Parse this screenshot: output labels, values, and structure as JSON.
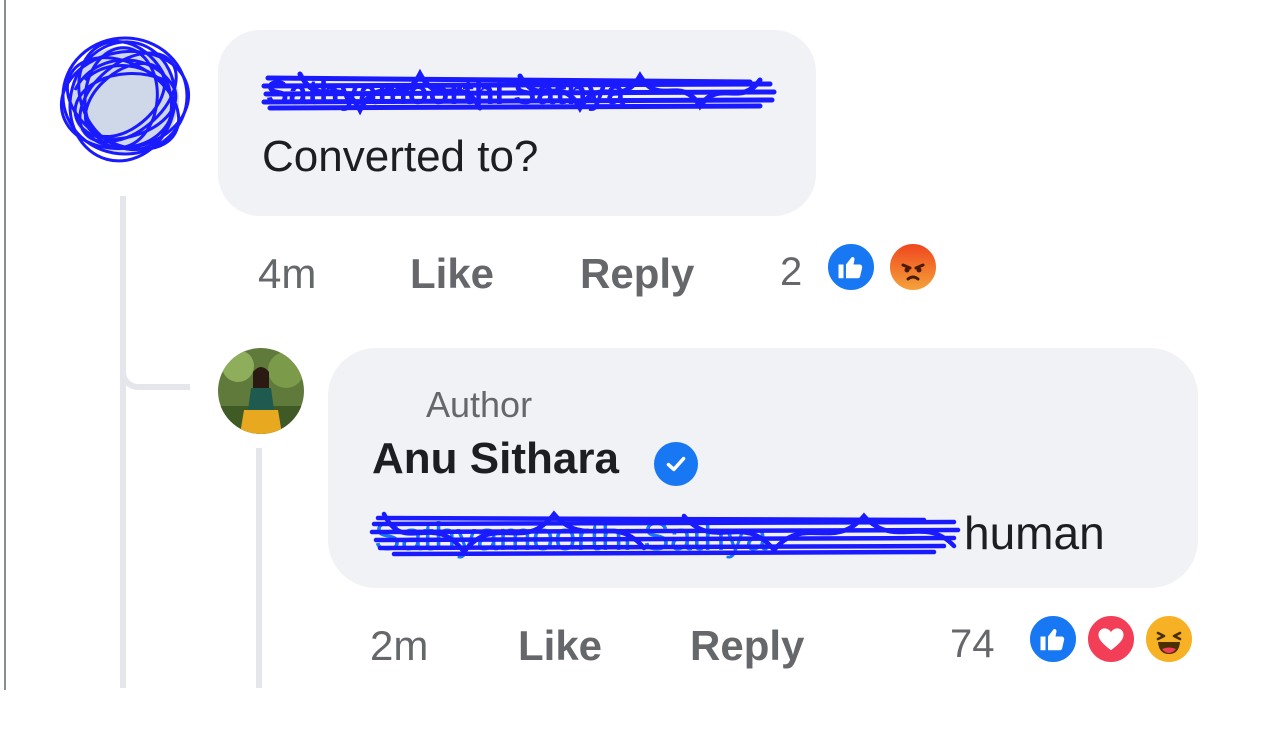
{
  "comment": {
    "author_name": "Sathyamoorthi Sathya",
    "text": "Converted to?",
    "time": "4m",
    "like_label": "Like",
    "reply_label": "Reply",
    "reaction_count": "2",
    "reactions": [
      "like-icon",
      "angry-icon"
    ]
  },
  "reply": {
    "badge": "Author",
    "author_name": "Anu Sithara",
    "mentioned_name": "Sathyamoorthi Sathya",
    "text": "human",
    "time": "2m",
    "like_label": "Like",
    "reply_label": "Reply",
    "reaction_count": "74",
    "reactions": [
      "like-icon",
      "love-icon",
      "haha-icon"
    ]
  },
  "colors": {
    "bubble": "#f0f2f5",
    "action_text": "#65676b",
    "scribble": "#1a1aff",
    "like_blue": "#1877f2"
  }
}
